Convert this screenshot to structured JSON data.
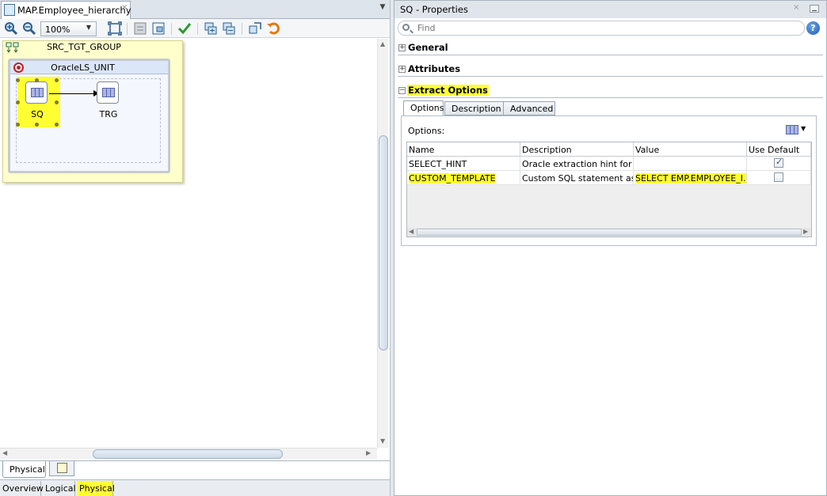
{
  "editor": {
    "tab_title": "MAP.Employee_hierarchy",
    "tab_close": "×",
    "zoom": "100%",
    "group_name": "SRC_TGT_GROUP",
    "unit_name": "OracleLS_UNIT",
    "source_node": "SQ",
    "target_node": "TRG",
    "diagram_tab": "Physical",
    "view_tabs": [
      "Overview",
      "Logical",
      "Physical"
    ],
    "icons": [
      "zoom-in-icon",
      "zoom-out-icon",
      "fit-icon",
      "layout-icon",
      "validate-icon",
      "add-group-icon",
      "remove-group-icon",
      "refresh-icon",
      "undo-icon"
    ]
  },
  "properties": {
    "title": "SQ - Properties",
    "close": "×",
    "find_placeholder": "Find",
    "help": "?",
    "sections": [
      {
        "label": "General",
        "expanded": false,
        "marker": "+"
      },
      {
        "label": "Attributes",
        "expanded": false,
        "marker": "+"
      },
      {
        "label": "Extract Options",
        "expanded": true,
        "marker": "−"
      }
    ],
    "tabs": [
      "Options",
      "Description",
      "Advanced"
    ],
    "options_label": "Options:",
    "table": {
      "headers": [
        "Name",
        "Description",
        "Value",
        "Use Default"
      ],
      "rows": [
        {
          "name": "SELECT_HINT",
          "description": "Oracle extraction hint for ...",
          "value": "",
          "use_default": true
        },
        {
          "name": "CUSTOM_TEMPLATE",
          "description": "Custom SQL statement as...",
          "value": "SELECT EMP.EMPLOYEE_I...",
          "use_default": false
        }
      ]
    }
  },
  "colors": {
    "highlight": "#ffff33",
    "group_fill": "#ffffcc",
    "unit_fill": "#f4f7fd",
    "accent": "#1e5cb3"
  }
}
